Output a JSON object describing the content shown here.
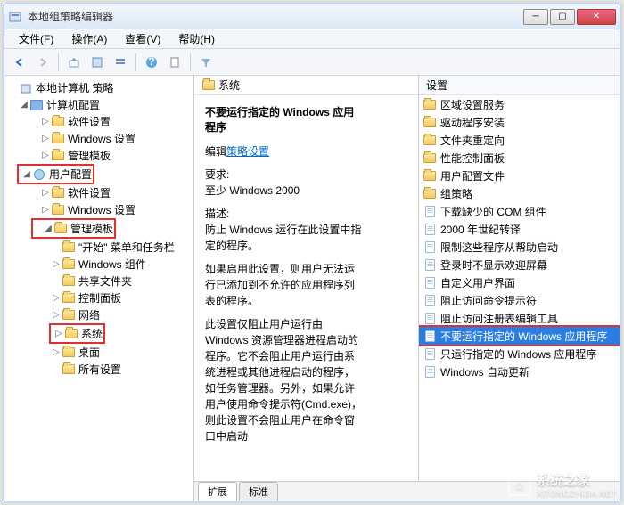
{
  "window": {
    "title": "本地组策略编辑器"
  },
  "menu": {
    "file": "文件(F)",
    "action": "操作(A)",
    "view": "查看(V)",
    "help": "帮助(H)"
  },
  "tree": {
    "root": "本地计算机 策略",
    "computer_config": "计算机配置",
    "cc_software": "软件设置",
    "cc_windows": "Windows 设置",
    "cc_admin": "管理模板",
    "user_config": "用户配置",
    "uc_software": "软件设置",
    "uc_windows": "Windows 设置",
    "uc_admin": "管理模板",
    "start_taskbar": "\"开始\" 菜单和任务栏",
    "win_components": "Windows 组件",
    "shared_folders": "共享文件夹",
    "control_panel": "控制面板",
    "network": "网络",
    "system": "系统",
    "desktop": "桌面",
    "all_settings": "所有设置"
  },
  "content": {
    "header_label": "系统",
    "title": "不要运行指定的 Windows 应用程序",
    "edit_prefix": "编辑",
    "edit_link": "策略设置",
    "req_label": "要求:",
    "req_value": "至少 Windows 2000",
    "desc_label": "描述:",
    "desc1": "防止 Windows 运行在此设置中指定的程序。",
    "desc2": "如果启用此设置，则用户无法运行已添加到不允许的应用程序列表的程序。",
    "desc3": "此设置仅阻止用户运行由 Windows 资源管理器进程启动的程序。它不会阻止用户运行由系统进程或其他进程启动的程序，如任务管理器。另外，如果允许用户使用命令提示符(Cmd.exe)，则此设置不会阻止用户在命令窗口中启动",
    "tabs": {
      "extended": "扩展",
      "standard": "标准"
    }
  },
  "right": {
    "header": "设置",
    "items": [
      "区域设置服务",
      "驱动程序安装",
      "文件夹重定向",
      "性能控制面板",
      "用户配置文件",
      "组策略",
      "下载缺少的 COM 组件",
      "2000 年世纪转译",
      "限制这些程序从帮助启动",
      "登录时不显示欢迎屏幕",
      "自定义用户界面",
      "阻止访问命令提示符",
      "阻止访问注册表编辑工具",
      "不要运行指定的 Windows 应用程序",
      "只运行指定的 Windows 应用程序",
      "Windows 自动更新"
    ],
    "selected_index": 13,
    "folder_count": 6
  },
  "watermark": {
    "text": "系统之家",
    "sub": "XITONGZHIJIA.NET"
  }
}
